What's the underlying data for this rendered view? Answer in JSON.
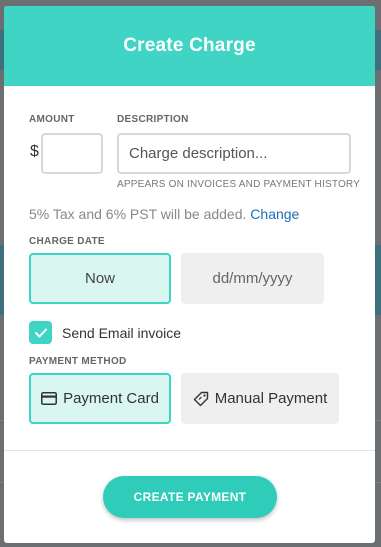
{
  "modal": {
    "title": "Create Charge"
  },
  "form": {
    "amount_label": "AMOUNT",
    "currency_symbol": "$",
    "amount_value": "",
    "description_label": "DESCRIPTION",
    "description_placeholder": "Charge description...",
    "description_hint": "APPEARS ON INVOICES AND PAYMENT HISTORY",
    "tax_text": "5% Tax and 6% PST will be added.",
    "tax_link": "Change",
    "charge_date_label": "CHARGE DATE",
    "now_option": "Now",
    "date_placeholder": "dd/mm/yyyy",
    "send_email_label": "Send Email invoice",
    "send_email_checked": true,
    "payment_method_label": "PAYMENT METHOD",
    "payment_card_label": "Payment Card",
    "manual_payment_label": "Manual Payment",
    "submit_label": "CREATE PAYMENT"
  },
  "icons": {
    "payment_card": "credit-card-icon",
    "manual_payment": "tag-icon",
    "checkbox": "check-icon"
  },
  "colors": {
    "accent": "#3fd4c3",
    "accent_light": "#d9f6f1",
    "link": "#1e6fb8"
  }
}
